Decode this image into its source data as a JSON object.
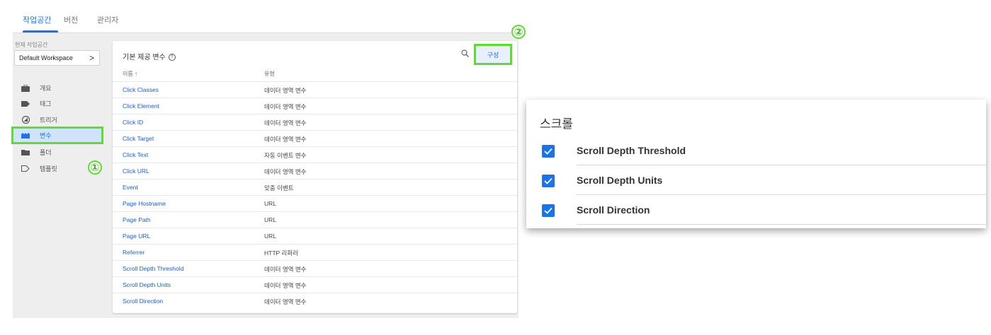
{
  "tabs": [
    {
      "label": "작업공간",
      "active": true
    },
    {
      "label": "버전",
      "active": false
    },
    {
      "label": "관리자",
      "active": false
    }
  ],
  "workspace": {
    "label": "현재 작업공간",
    "name": "Default Workspace",
    "chevron": ">"
  },
  "nav": [
    {
      "label": "개요",
      "icon": "briefcase-icon"
    },
    {
      "label": "태그",
      "icon": "tag-icon"
    },
    {
      "label": "트리거",
      "icon": "trigger-icon"
    },
    {
      "label": "변수",
      "icon": "variables-icon",
      "selected": true
    },
    {
      "label": "폴더",
      "icon": "folder-icon"
    },
    {
      "label": "템플릿",
      "icon": "template-icon"
    }
  ],
  "callouts": {
    "one": "①",
    "two": "②"
  },
  "card": {
    "title": "기본 제공 변수",
    "help": "?",
    "configure_label": "구성",
    "col_name": "이름 ↑",
    "col_type": "유형",
    "rows": [
      {
        "name": "Click Classes",
        "type": "데이터 영역 변수"
      },
      {
        "name": "Click Element",
        "type": "데이터 영역 변수"
      },
      {
        "name": "Click ID",
        "type": "데이터 영역 변수"
      },
      {
        "name": "Click Target",
        "type": "데이터 영역 변수"
      },
      {
        "name": "Click Text",
        "type": "자동 이벤트 변수"
      },
      {
        "name": "Click URL",
        "type": "데이터 영역 변수"
      },
      {
        "name": "Event",
        "type": "맞춤 이벤트"
      },
      {
        "name": "Page Hostname",
        "type": "URL"
      },
      {
        "name": "Page Path",
        "type": "URL"
      },
      {
        "name": "Page URL",
        "type": "URL"
      },
      {
        "name": "Referrer",
        "type": "HTTP 리퍼러"
      },
      {
        "name": "Scroll Depth Threshold",
        "type": "데이터 영역 변수"
      },
      {
        "name": "Scroll Depth Units",
        "type": "데이터 영역 변수"
      },
      {
        "name": "Scroll Direction",
        "type": "데이터 영역 변수"
      }
    ]
  },
  "scroll_panel": {
    "title": "스크롤",
    "items": [
      {
        "label": "Scroll Depth Threshold",
        "checked": true
      },
      {
        "label": "Scroll Depth Units",
        "checked": true
      },
      {
        "label": "Scroll Direction",
        "checked": true
      }
    ]
  },
  "colors": {
    "accent": "#1a73e8",
    "highlight": "#5edc2f",
    "selected_bg": "#d0e3fa"
  }
}
